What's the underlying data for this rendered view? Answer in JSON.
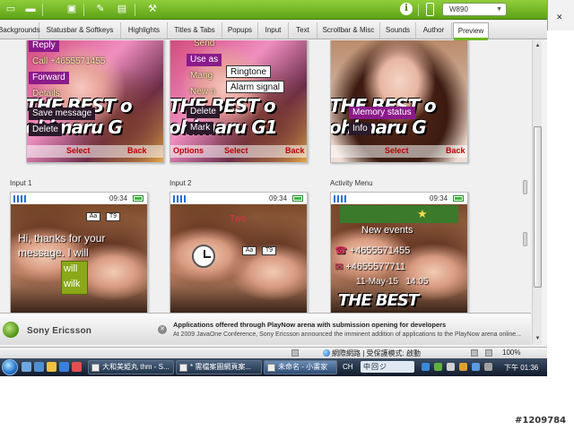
{
  "toolbar": {
    "model": "W890",
    "info_glyph": "i",
    "icon_names": [
      "folder-icon",
      "folder-open-icon",
      "save-icon",
      "color-icon",
      "text-icon",
      "settings-icon",
      "info-icon",
      "phone-icon"
    ]
  },
  "tabs": [
    {
      "label": "Backgrounds",
      "active": false
    },
    {
      "label": "Statusbar & Softkeys",
      "active": false
    },
    {
      "label": "Highlights",
      "active": false
    },
    {
      "label": "Titles & Tabs",
      "active": false
    },
    {
      "label": "Popups",
      "active": false
    },
    {
      "label": "Input",
      "active": false
    },
    {
      "label": "Text",
      "active": false
    },
    {
      "label": "Scrollbar & Misc",
      "active": false
    },
    {
      "label": "Sounds",
      "active": false
    },
    {
      "label": "Author",
      "active": false
    },
    {
      "label": "Preview",
      "active": true
    }
  ],
  "preview_top": {
    "shot1": {
      "menu": [
        "Reply",
        "Call +4655571455",
        "Forward",
        "Details",
        "Save message",
        "Delete"
      ],
      "brand": [
        "THE BEST o",
        "ohimaru G"
      ],
      "softkeys": {
        "center": "Select",
        "right": "Back"
      }
    },
    "shot2": {
      "menu": [
        "Send",
        "Use as",
        "Mang",
        "Ringtone",
        "New n",
        "Alarm signal",
        "Delete",
        "Mark"
      ],
      "brand": [
        "THE BEST o",
        "ohimaru G1"
      ],
      "softkeys": {
        "left": "Options",
        "center": "Select",
        "right": "Back"
      }
    },
    "shot3": {
      "menu": [
        "Memory status",
        "Info"
      ],
      "brand": [
        "THE BEST o",
        "ohimaru G"
      ],
      "softkeys": {
        "center": "Select",
        "right": "Back"
      }
    }
  },
  "preview_bottom": {
    "shot1": {
      "caption": "Input 1",
      "time": "09:34",
      "keys": [
        "Aa",
        "T9"
      ],
      "text": [
        "Hi, thanks for your",
        "message. I will"
      ],
      "suggestions": [
        "will",
        "wilk"
      ]
    },
    "shot2": {
      "caption": "Input 2",
      "time": "09:34",
      "keys": [
        "Aa",
        "T9"
      ],
      "title": "Two"
    },
    "shot3": {
      "caption": "Activity Menu",
      "time": "09:34",
      "header": "New events",
      "events": [
        "+4655571455",
        "+4655577711",
        "11-May-15   14:05"
      ],
      "brand": "THE BEST"
    }
  },
  "newsbar": {
    "brand": "Sony Ericsson",
    "title": "Applications offered through PlayNow arena with submission opening for developers",
    "body": "At 2009 JavaOne Conference, Sony Ericsson announced the imminent addition of applications to the PlayNow arena online..."
  },
  "statusbar": {
    "zone": "網際網路 | 受保護模式: 啟動",
    "zoom": "100%"
  },
  "taskbar": {
    "tasks": [
      {
        "label": "大和美姫丸 thm - S...",
        "active": false
      },
      {
        "label": "* 需檔案圖網頁案...",
        "active": false
      },
      {
        "label": "未命名 - 小畫家",
        "active": true
      }
    ],
    "lang": "CH",
    "ime": "中回ジ",
    "clock": "下午 01:36"
  },
  "watermark": "#1209784",
  "colors": {
    "accent_green": "#6cb81f",
    "menu_magenta": "#8a1a8a",
    "softkey_red": "#b00000"
  }
}
